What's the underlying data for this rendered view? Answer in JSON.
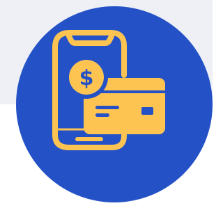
{
  "icon": {
    "name": "mobile-payment-card-icon",
    "currency_symbol": "$"
  },
  "colors": {
    "circle": "#2452c6",
    "icon": "#fdc452",
    "background_top": "#eef0f6",
    "background_bottom": "#ffffff"
  }
}
